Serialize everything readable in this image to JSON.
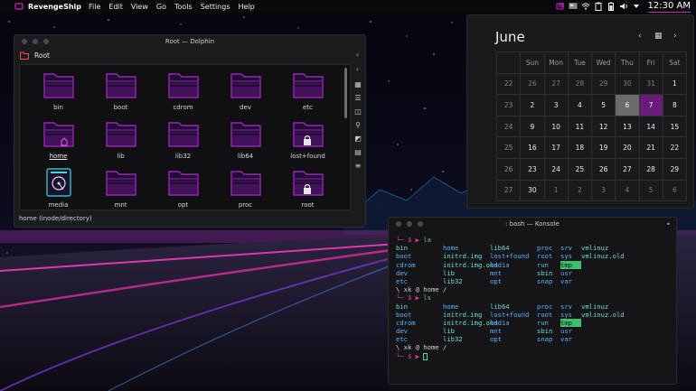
{
  "topbar": {
    "app_name": "RevengeShip",
    "menus": [
      "File",
      "Edit",
      "View",
      "Go",
      "Tools",
      "Settings",
      "Help"
    ],
    "clock": "12:30 AM",
    "tray_icons": [
      "window-switcher-icon",
      "monitor-icon",
      "wifi-icon",
      "clipboard-icon",
      "battery-icon",
      "volume-icon",
      "arrow-down-icon"
    ],
    "accent_color": "#d01fcc"
  },
  "dolphin": {
    "title": "Root — Dolphin",
    "location": "Root",
    "status": "home (inode/directory)",
    "files": [
      {
        "name": "bin",
        "icon": "folder-icon"
      },
      {
        "name": "boot",
        "icon": "folder-icon"
      },
      {
        "name": "cdrom",
        "icon": "folder-icon"
      },
      {
        "name": "dev",
        "icon": "folder-icon"
      },
      {
        "name": "etc",
        "icon": "folder-icon"
      },
      {
        "name": "home",
        "icon": "folder-home-icon",
        "selected": true
      },
      {
        "name": "lib",
        "icon": "folder-icon"
      },
      {
        "name": "lib32",
        "icon": "folder-icon"
      },
      {
        "name": "lib64",
        "icon": "folder-icon"
      },
      {
        "name": "lost+found",
        "icon": "folder-locked-icon"
      },
      {
        "name": "media",
        "icon": "drive-icon"
      },
      {
        "name": "mnt",
        "icon": "folder-icon"
      },
      {
        "name": "opt",
        "icon": "folder-icon"
      },
      {
        "name": "proc",
        "icon": "folder-icon"
      },
      {
        "name": "root",
        "icon": "folder-locked-icon"
      }
    ],
    "folder_color": "#b02bd1"
  },
  "calendar": {
    "month": "June",
    "weekdays": [
      "Sun",
      "Mon",
      "Tue",
      "Wed",
      "Thu",
      "Fri",
      "Sat"
    ],
    "weeks": [
      {
        "wk": "22",
        "days": [
          "26",
          "27",
          "28",
          "29",
          "30",
          "31",
          "1"
        ]
      },
      {
        "wk": "23",
        "days": [
          "2",
          "3",
          "4",
          "5",
          "6",
          "7",
          "8"
        ]
      },
      {
        "wk": "24",
        "days": [
          "9",
          "10",
          "11",
          "12",
          "13",
          "14",
          "15"
        ]
      },
      {
        "wk": "25",
        "days": [
          "16",
          "17",
          "18",
          "19",
          "20",
          "21",
          "22"
        ]
      },
      {
        "wk": "26",
        "days": [
          "23",
          "24",
          "25",
          "26",
          "27",
          "28",
          "29"
        ]
      },
      {
        "wk": "27",
        "days": [
          "30",
          "1",
          "2",
          "3",
          "4",
          "5",
          "6"
        ]
      }
    ],
    "today": "6",
    "selected": "7",
    "selected_color": "#6a1a78"
  },
  "konsole": {
    "title": ": bash — Konsole",
    "prompt_sym": "└─ $ ▶",
    "prompt_path": "\\ xk @ home /",
    "cmd1": "la",
    "cmd2": "ls",
    "ls_rows": [
      [
        "bin",
        "home",
        "lib64",
        "proc",
        "srv",
        "vmlinuz"
      ],
      [
        "boot",
        "initrd.img",
        "lost+found",
        "root",
        "sys",
        "vmlinuz.old"
      ],
      [
        "cdrom",
        "initrd.img.old",
        "media",
        "run",
        "tmp",
        ""
      ],
      [
        "dev",
        "lib",
        "mnt",
        "sbin",
        "usr",
        ""
      ],
      [
        "etc",
        "lib32",
        "opt",
        "snap",
        "var",
        ""
      ]
    ]
  }
}
